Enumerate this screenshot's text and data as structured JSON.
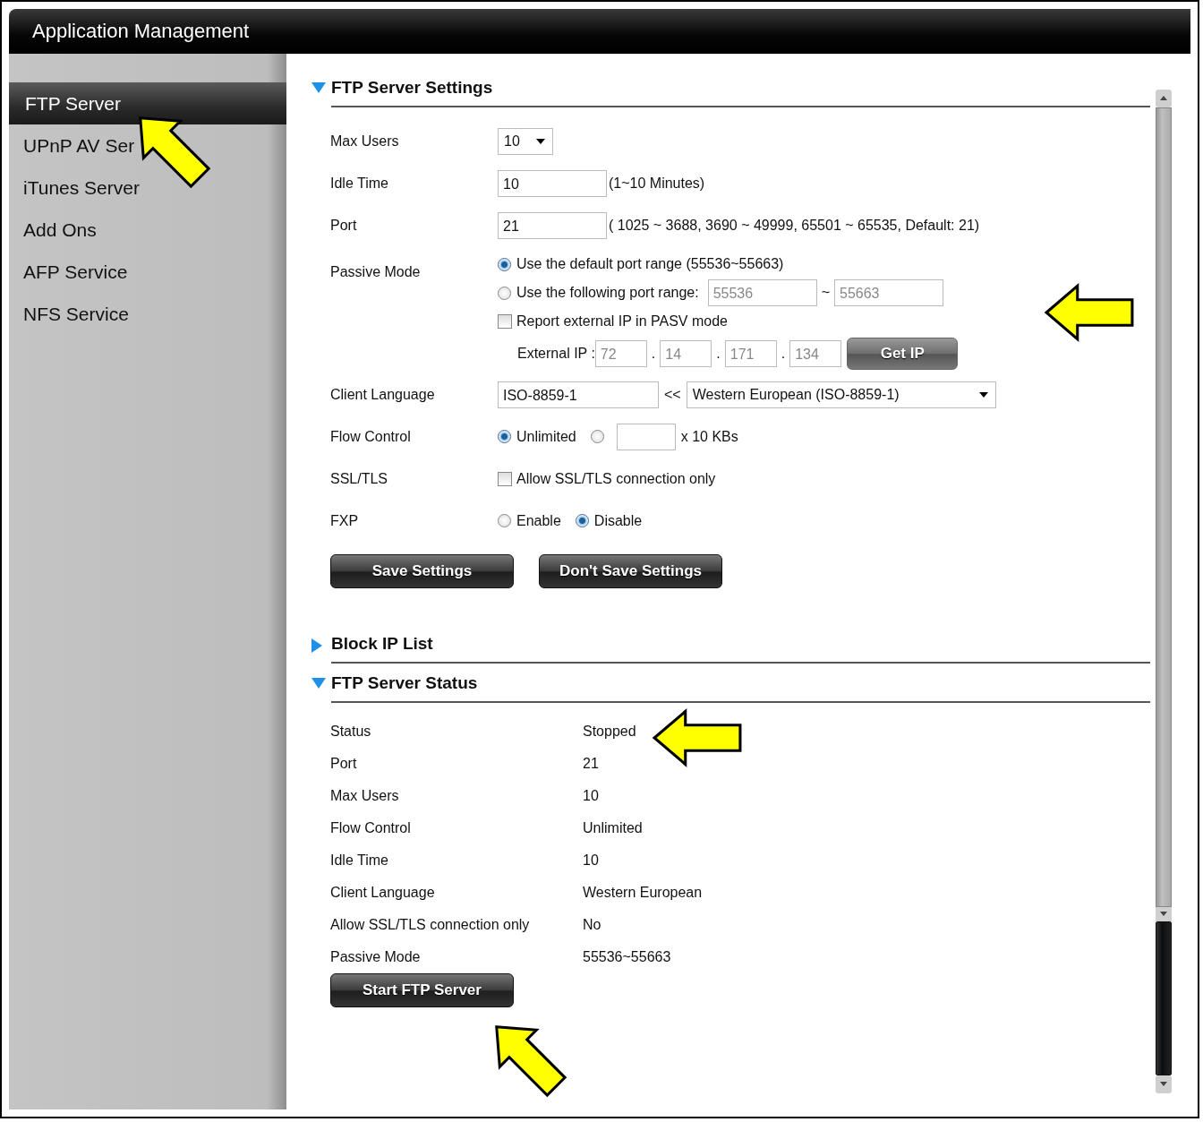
{
  "window": {
    "title": "Application Management"
  },
  "sidebar": {
    "items": [
      {
        "label": "FTP Server",
        "selected": true
      },
      {
        "label": "UPnP AV Ser",
        "selected": false
      },
      {
        "label": "iTunes Server",
        "selected": false
      },
      {
        "label": "Add Ons",
        "selected": false
      },
      {
        "label": "AFP Service",
        "selected": false
      },
      {
        "label": "NFS Service",
        "selected": false
      }
    ]
  },
  "settings": {
    "title": "FTP Server Settings",
    "expanded": true,
    "fields": [
      {
        "kind": "select",
        "label": "Max Users",
        "value": "10"
      },
      {
        "kind": "text",
        "label": "Idle Time",
        "value": "10",
        "note": "(1~10 Minutes)"
      },
      {
        "kind": "text",
        "label": "Port",
        "value": "21",
        "note": "( 1025 ~ 3688, 3690 ~ 49999, 65501 ~ 65535, Default: 21)"
      },
      {
        "kind": "passive",
        "label": "Passive Mode",
        "options": [
          {
            "label": "Use the default port range (55536~55663)",
            "selected": true
          },
          {
            "label": "Use the following port range:",
            "selected": false,
            "from": "55536",
            "separator": "~",
            "to": "55663",
            "disabled": true
          }
        ],
        "report": {
          "label": "Report external IP in PASV mode",
          "checked": false
        },
        "external_ip": {
          "label": "External IP :",
          "octets": [
            "72",
            "14",
            "171",
            "134"
          ],
          "separators": [
            ".",
            ".",
            "."
          ],
          "disabled": true,
          "button": "Get IP"
        }
      },
      {
        "kind": "language",
        "label": "Client Language",
        "value": "ISO-8859-1",
        "arrow": "<<",
        "select": "Western European (ISO-8859-1)"
      },
      {
        "kind": "flow",
        "label": "Flow Control",
        "options": [
          {
            "label": "Unlimited",
            "selected": true
          },
          {
            "selected": false,
            "unit": "x 10 KBs"
          }
        ]
      },
      {
        "kind": "checkbox",
        "label": "SSL/TLS",
        "text": "Allow SSL/TLS connection only",
        "checked": false
      },
      {
        "kind": "radio",
        "label": "FXP",
        "options": [
          {
            "label": "Enable",
            "selected": false
          },
          {
            "label": "Disable",
            "selected": true
          }
        ]
      }
    ],
    "buttons": [
      "Save Settings",
      "Don't Save Settings"
    ]
  },
  "block_ip": {
    "title": "Block IP List",
    "expanded": false
  },
  "status": {
    "title": "FTP Server Status",
    "expanded": true,
    "rows": [
      {
        "label": "Status",
        "value": "Stopped"
      },
      {
        "label": "Port",
        "value": "21"
      },
      {
        "label": "Max Users",
        "value": "10"
      },
      {
        "label": "Flow Control",
        "value": "Unlimited"
      },
      {
        "label": "Idle Time",
        "value": "10"
      },
      {
        "label": "Client Language",
        "value": "Western European"
      },
      {
        "label": "Allow SSL/TLS connection only",
        "value": "No"
      },
      {
        "label": "Passive Mode",
        "value": "55536~55663"
      }
    ],
    "button": "Start FTP Server"
  }
}
